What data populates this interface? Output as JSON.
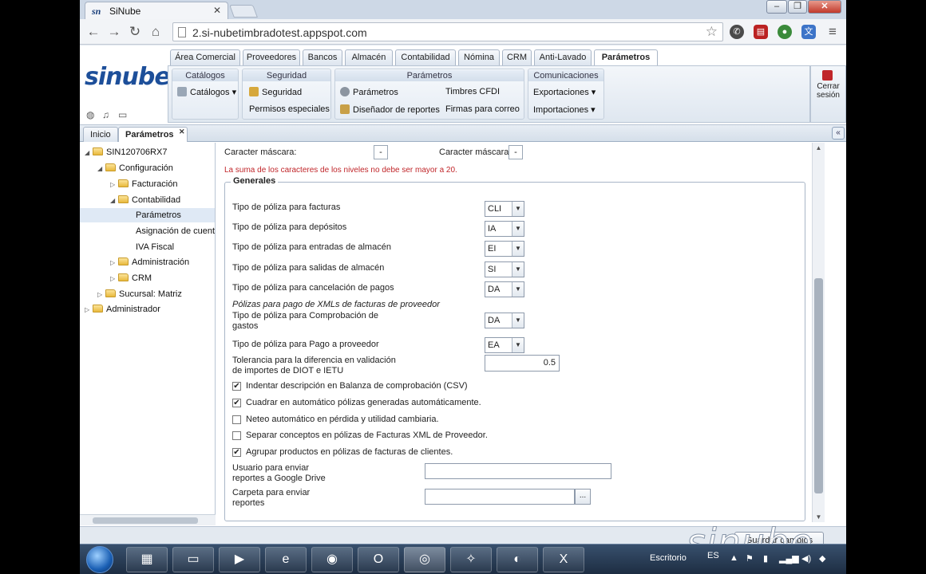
{
  "browser": {
    "tab_title": "SiNube",
    "tab_favicon": "sn",
    "url": "2.si-nubetimbradotest.appspot.com"
  },
  "app": {
    "logo": "sinube",
    "main_tabs": [
      "Área Comercial",
      "Proveedores",
      "Bancos",
      "Almacén",
      "Contabilidad",
      "Nómina",
      "CRM",
      "Anti-Lavado",
      "Parámetros"
    ],
    "ribbon": {
      "catalogos": {
        "title": "Catálogos",
        "item": "Catálogos"
      },
      "seguridad": {
        "title": "Seguridad",
        "item1": "Seguridad",
        "item2": "Permisos especiales"
      },
      "parametros": {
        "title": "Parámetros",
        "item1": "Parámetros",
        "item2": "Diseñador de reportes",
        "item3": "Timbres CFDI",
        "item4": "Firmas para correo"
      },
      "comunicaciones": {
        "title": "Comunicaciones",
        "item1": "Exportaciones",
        "item2": "Importaciones"
      }
    },
    "logout": "Cerrar sesión",
    "page_tabs": [
      "Inicio",
      "Parámetros"
    ]
  },
  "tree": [
    "SIN120706RX7",
    "Configuración",
    "Facturación",
    "Contabilidad",
    "Parámetros",
    "Asignación de cuenta",
    "IVA Fiscal",
    "Administración",
    "CRM",
    "Sucursal: Matriz",
    "Administrador"
  ],
  "form": {
    "mask1_label": "Caracter máscara:",
    "mask1_value": "-",
    "mask2_label": "Caracter máscara:",
    "mask2_value": "-",
    "warning": "La suma de los caracteres de los niveles no debe ser mayor a 20.",
    "section": "Generales",
    "rows": [
      {
        "label": "Tipo de póliza para facturas",
        "value": "CLI"
      },
      {
        "label": "Tipo de póliza para depósitos",
        "value": "IA"
      },
      {
        "label": "Tipo de póliza para entradas de almacén",
        "value": "EI"
      },
      {
        "label": "Tipo de póliza para salidas de almacén",
        "value": "SI"
      },
      {
        "label": "Tipo de póliza para cancelación de pagos",
        "value": "DA"
      }
    ],
    "subheading": "Pólizas para pago de XMLs de facturas de proveedor",
    "rows2": [
      {
        "label1": "Tipo de póliza para Comprobación de",
        "label2": "gastos",
        "value": "DA"
      },
      {
        "label1": "Tipo de póliza para Pago a proveedor",
        "label2": "",
        "value": "EA"
      }
    ],
    "tolerance_label1": "Tolerancia para la diferencia en validación",
    "tolerance_label2": "de importes de DIOT e IETU",
    "tolerance_value": "0.5",
    "checks": [
      {
        "label": "Indentar descripción en Balanza de comprobación (CSV)",
        "checked": true
      },
      {
        "label": "Cuadrar en automático pólizas generadas automáticamente.",
        "checked": true
      },
      {
        "label": "Neteo automático en pérdida y utilidad cambiaria.",
        "checked": false
      },
      {
        "label": "Separar conceptos en pólizas de Facturas XML de Proveedor.",
        "checked": false
      },
      {
        "label": "Agrupar productos en pólizas de facturas de clientes.",
        "checked": true
      }
    ],
    "user_label1": "Usuario para enviar",
    "user_label2": "reportes a Google Drive",
    "folder_label1": "Carpeta para enviar",
    "folder_label2": "reportes",
    "browse": "...",
    "save": "Guardar cambios"
  },
  "watermark": "sinube",
  "taskbar": {
    "escritorio": "Escritorio",
    "lang": "ES"
  }
}
